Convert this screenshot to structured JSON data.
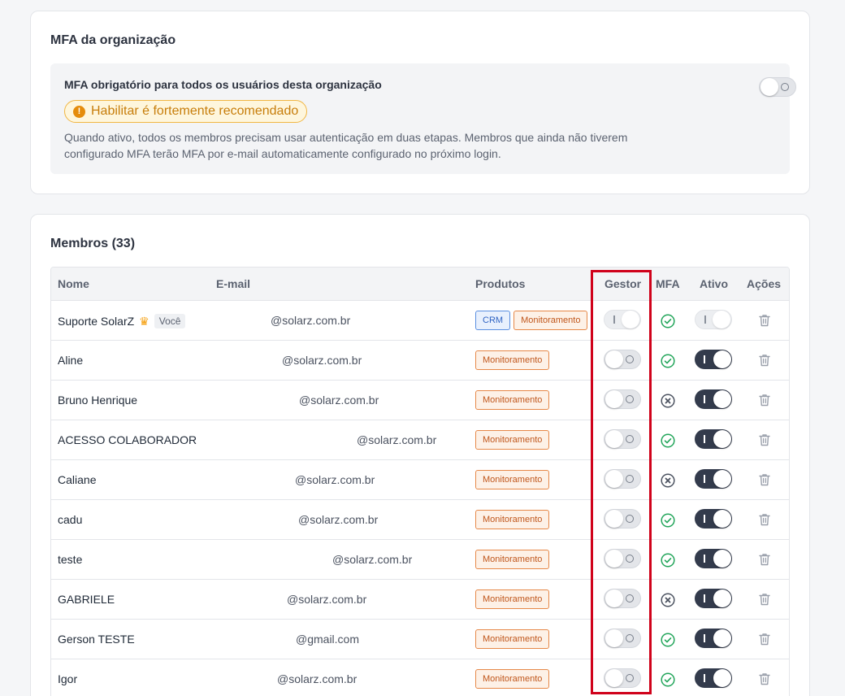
{
  "mfa": {
    "title": "MFA da organização",
    "heading": "MFA obrigatório para todos os usuários desta organização",
    "warning": "Habilitar é fortemente recomendado",
    "description": "Quando ativo, todos os membros precisam usar autenticação em duas etapas. Membros que ainda não tiverem configurado MFA terão MFA por e-mail automaticamente configurado no próximo login.",
    "enabled": false
  },
  "members": {
    "title": "Membros (33)",
    "columns": {
      "name": "Nome",
      "email": "E-mail",
      "products": "Produtos",
      "manager": "Gestor",
      "mfa": "MFA",
      "active": "Ativo",
      "actions": "Ações"
    },
    "rows": [
      {
        "name": "Suporte SolarZ",
        "you": "Você",
        "email": "@solarz.com.br",
        "products": [
          "CRM",
          "Monitoramento"
        ],
        "manager": true,
        "mfa": true,
        "active": true,
        "locked": true
      },
      {
        "name": "Aline",
        "email": "@solarz.com.br",
        "products": [
          "Monitoramento"
        ],
        "manager": false,
        "mfa": true,
        "active": true
      },
      {
        "name": "Bruno Henrique",
        "email": "@solarz.com.br",
        "products": [
          "Monitoramento"
        ],
        "manager": false,
        "mfa": false,
        "active": true
      },
      {
        "name": "ACESSO COLABORADOR",
        "email": "@solarz.com.br",
        "products": [
          "Monitoramento"
        ],
        "manager": false,
        "mfa": true,
        "active": true
      },
      {
        "name": "Caliane",
        "email": "@solarz.com.br",
        "products": [
          "Monitoramento"
        ],
        "manager": false,
        "mfa": false,
        "active": true
      },
      {
        "name": "cadu",
        "email": "@solarz.com.br",
        "products": [
          "Monitoramento"
        ],
        "manager": false,
        "mfa": true,
        "active": true
      },
      {
        "name": "teste",
        "email": "@solarz.com.br",
        "products": [
          "Monitoramento"
        ],
        "manager": false,
        "mfa": true,
        "active": true
      },
      {
        "name": "GABRIELE",
        "email": "@solarz.com.br",
        "products": [
          "Monitoramento"
        ],
        "manager": false,
        "mfa": false,
        "active": true
      },
      {
        "name": "Gerson TESTE",
        "email": "@gmail.com",
        "products": [
          "Monitoramento"
        ],
        "manager": false,
        "mfa": true,
        "active": true
      },
      {
        "name": "Igor",
        "email": "@solarz.com.br",
        "products": [
          "Monitoramento"
        ],
        "manager": false,
        "mfa": true,
        "active": true
      }
    ]
  },
  "icons": {
    "warning": "exclamation-circle-icon",
    "crown": "crown-icon",
    "mfa_on": "check-circle-icon",
    "mfa_off": "x-circle-icon",
    "delete": "trash-icon"
  },
  "colors": {
    "accent_dark": "#333b4c",
    "success": "#22a55a",
    "warning": "#e58c0b",
    "highlight": "#d0021b"
  }
}
